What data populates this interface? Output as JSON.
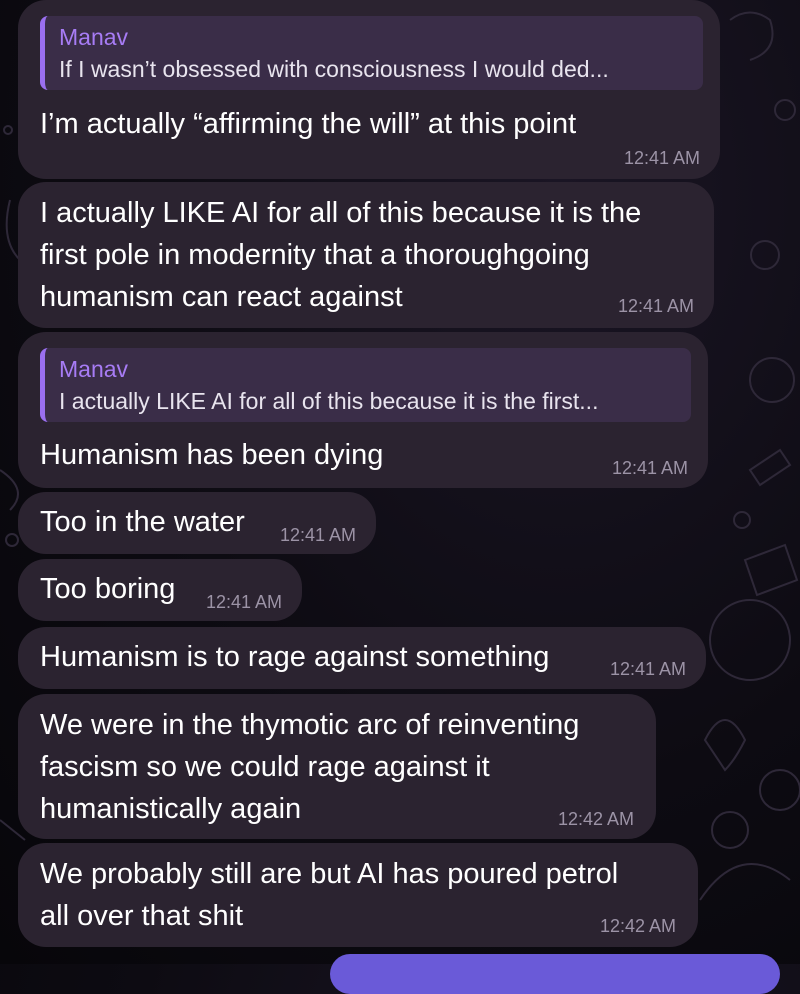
{
  "messages": [
    {
      "reply_name": "Manav",
      "reply_text": "If I wasn’t obsessed with consciousness I would ded...",
      "text": "I’m actually “affirming the will” at this point",
      "time": "12:41 AM"
    },
    {
      "text": "I actually LIKE AI for all of this because it is the\nfirst pole in modernity that a thoroughgoing\nhumanism can react against",
      "time": "12:41 AM"
    },
    {
      "reply_name": "Manav",
      "reply_text": "I actually LIKE AI for all of this because it is the first...",
      "text": "Humanism has been dying",
      "time": "12:41 AM"
    },
    {
      "text": "Too in the water",
      "time": "12:41 AM"
    },
    {
      "text": "Too boring",
      "time": "12:41 AM"
    },
    {
      "text": "Humanism is to rage against something",
      "time": "12:41 AM"
    },
    {
      "text": "We were in the thymotic arc of reinventing\nfascism so we could rage against it\nhumanistically again",
      "time": "12:42 AM"
    },
    {
      "text": "We probably still are but AI has poured petrol\nall over that shit",
      "time": "12:42 AM"
    }
  ]
}
